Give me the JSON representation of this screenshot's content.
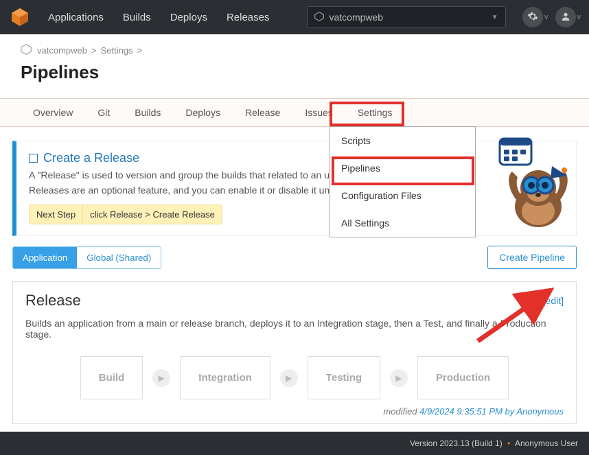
{
  "topnav": {
    "links": [
      "Applications",
      "Builds",
      "Deploys",
      "Releases"
    ],
    "app_selector": "vatcompweb"
  },
  "breadcrumb": {
    "app": "vatcompweb",
    "section": "Settings"
  },
  "page_title": "Pipelines",
  "tabs": [
    "Overview",
    "Git",
    "Builds",
    "Deploys",
    "Release",
    "Issues",
    "Settings"
  ],
  "settings_menu": [
    "Scripts",
    "Pipelines",
    "Configuration Files",
    "All Settings"
  ],
  "info": {
    "heading": "Create a Release",
    "line1": "A \"Release\" is used to version and group the builds that related to an upc",
    "line2": "Releases are an optional feature, and you can enable it or disable it under",
    "next_step_label": "Next Step",
    "next_step_text": "click Release > Create Release"
  },
  "segmented": {
    "active": "Application",
    "inactive": "Global (Shared)"
  },
  "create_button": "Create Pipeline",
  "pipeline": {
    "name": "Release",
    "edit": "[edit]",
    "description": "Builds an application from a main or release branch, deploys it to an Integration stage, then a Test, and finally a Production stage.",
    "stages": [
      "Build",
      "Integration",
      "Testing",
      "Production"
    ],
    "modified_prefix": "modified",
    "modified_link": "4/9/2024 9:35:51 PM by Anonymous"
  },
  "footer": {
    "version": "Version 2023.13 (Build 1)",
    "user": "Anonymous User"
  }
}
